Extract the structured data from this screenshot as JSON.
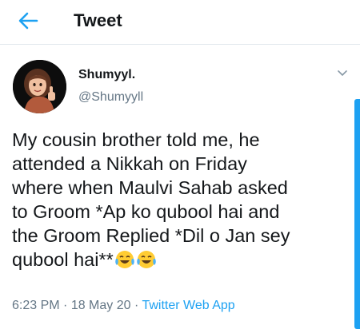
{
  "header": {
    "title": "Tweet",
    "back_icon": "arrow-left-icon"
  },
  "tweet": {
    "author": {
      "display_name": "Shumyyl.",
      "handle": "@Shumyyll"
    },
    "text": "My cousin brother told me, he\nattended a Nikkah on Friday\nwhere when Maulvi Sahab asked\nto Groom *Ap ko qubool hai and\nthe Groom Replied *Dil o Jan sey\nqubool hai**",
    "emojis": [
      "face-with-tears-of-joy",
      "face-with-tears-of-joy"
    ],
    "time": "6:23 PM",
    "separator": " · ",
    "date": "18 May 20",
    "source": "Twitter Web App"
  },
  "colors": {
    "accent": "#1da1f2",
    "muted": "#657786",
    "text": "#14171a"
  }
}
